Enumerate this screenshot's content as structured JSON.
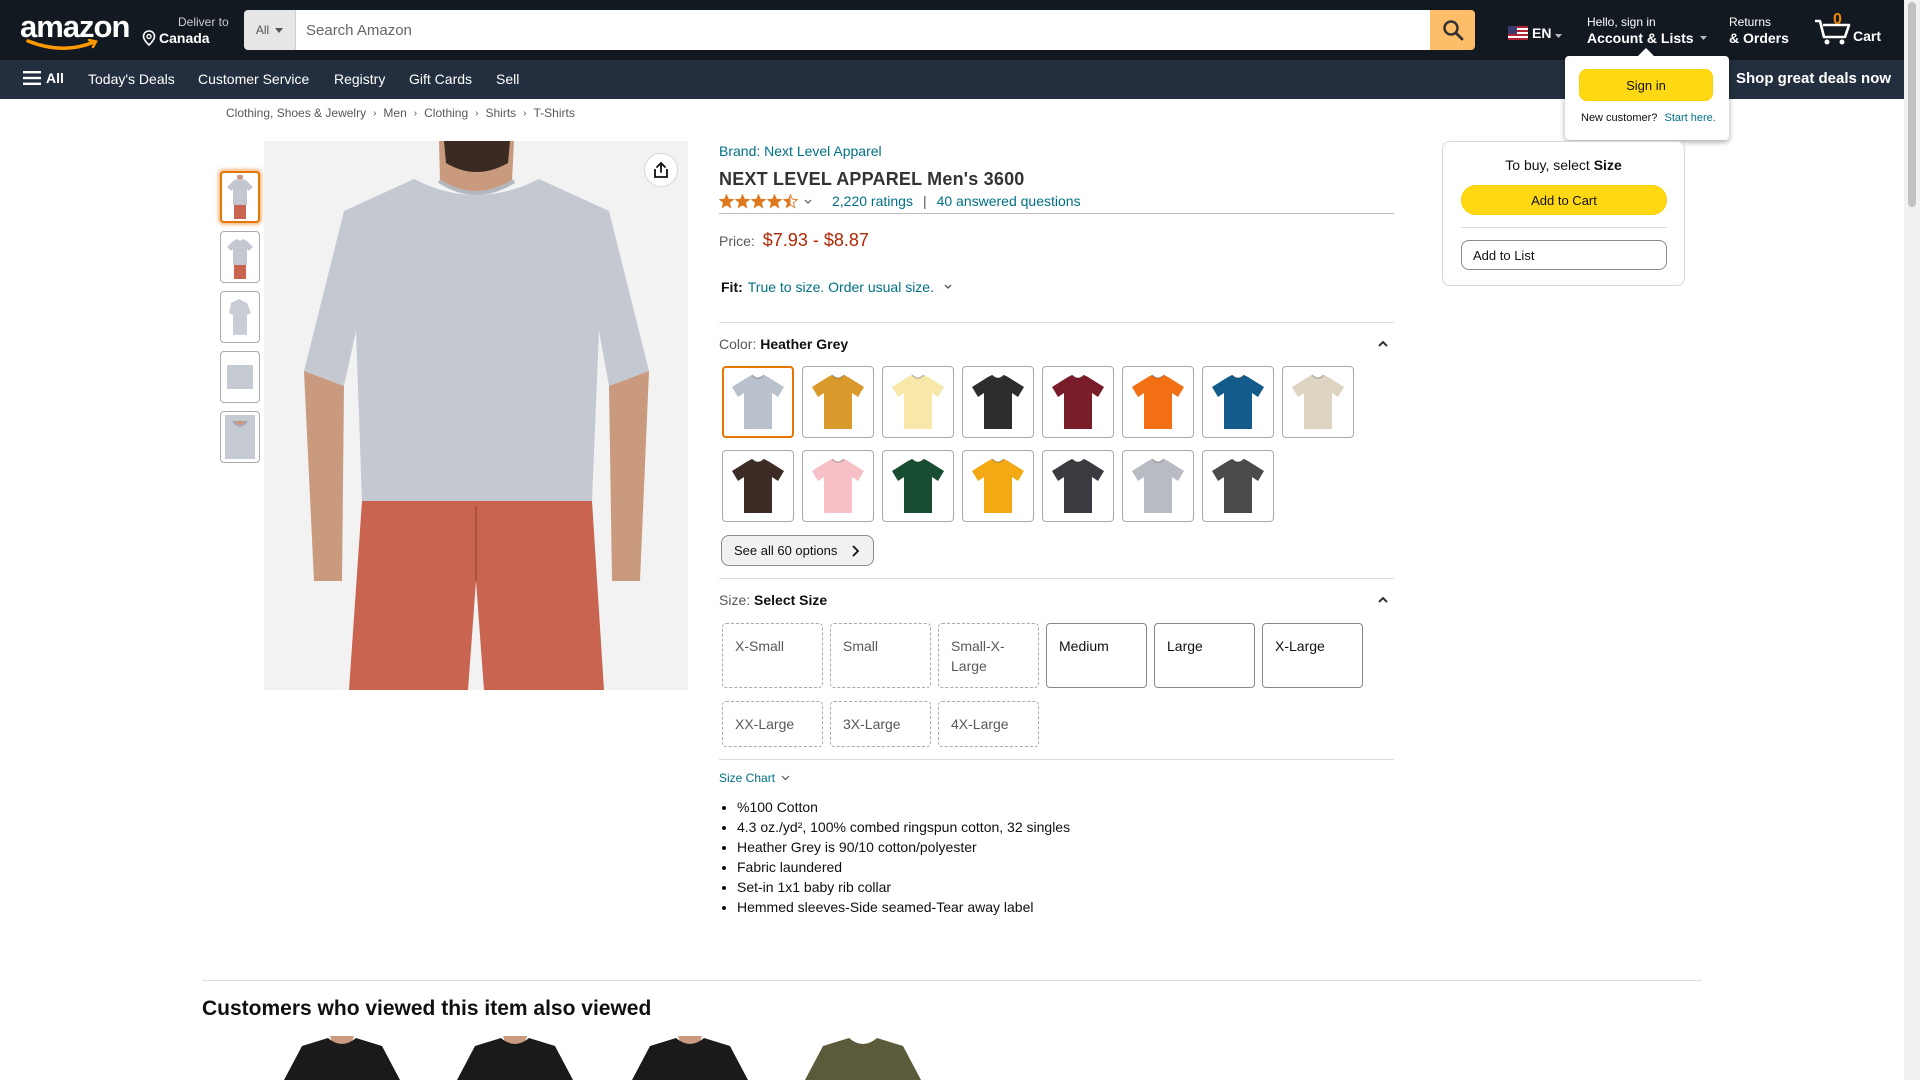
{
  "header": {
    "logo": "amazon",
    "deliver_line1": "Deliver to",
    "deliver_line2": "Canada",
    "search_category": "All",
    "search_placeholder": "Search Amazon",
    "language": "EN",
    "account_line1": "Hello, sign in",
    "account_line2": "Account & Lists",
    "returns_line1": "Returns",
    "returns_line2": "& Orders",
    "cart_count": "0",
    "cart_label": "Cart"
  },
  "subnav": {
    "all_label": "All",
    "items": [
      "Today's Deals",
      "Customer Service",
      "Registry",
      "Gift Cards",
      "Sell"
    ],
    "promo": "Shop great deals now"
  },
  "flyout": {
    "sign_in": "Sign in",
    "new_customer": "New customer?",
    "start_here": "Start here."
  },
  "breadcrumb": [
    "Clothing, Shoes & Jewelry",
    "Men",
    "Clothing",
    "Shirts",
    "T-Shirts"
  ],
  "product": {
    "brand": "Brand: Next Level Apparel",
    "title": "NEXT LEVEL APPAREL Men's 3600",
    "rating": 4.5,
    "ratings_count": "2,220 ratings",
    "separator": "|",
    "questions": "40 answered questions",
    "price_label": "Price:",
    "price": "$7.93 - $8.87",
    "fit_label": "Fit:",
    "fit_value": "True to size. Order usual size.",
    "color_label": "Color:",
    "color_value": "Heather Grey",
    "see_all": "See all 60 options",
    "size_label": "Size:",
    "size_value": "Select Size",
    "sizes": [
      {
        "label": "X-Small",
        "available": false
      },
      {
        "label": "Small",
        "available": false
      },
      {
        "label": "Small-X-Large",
        "available": false
      },
      {
        "label": "Medium",
        "available": true
      },
      {
        "label": "Large",
        "available": true
      },
      {
        "label": "X-Large",
        "available": true
      },
      {
        "label": "XX-Large",
        "available": false
      },
      {
        "label": "3X-Large",
        "available": false
      },
      {
        "label": "4X-Large",
        "available": false
      }
    ],
    "size_chart": "Size Chart",
    "bullets": [
      "%100 Cotton",
      "4.3 oz./yd², 100% combed ringspun cotton, 32 singles",
      "Heather Grey is 90/10 cotton/polyester",
      "Fabric laundered",
      "Set-in 1x1 baby rib collar",
      "Hemmed sleeves-Side seamed-Tear away label"
    ],
    "swatch_colors": [
      "#b9c1cc",
      "#d99a2b",
      "#f7e7a8",
      "#2d2d2d",
      "#7a1d2a",
      "#f36f14",
      "#135b8a",
      "#ddd4c2",
      "#3d2c25",
      "#f6c0c6",
      "#184d32",
      "#f2a914",
      "#3a3a40",
      "#b8bcc2",
      "#4b4b4d"
    ]
  },
  "buybox": {
    "prompt": "To buy, select",
    "prompt_bold": "Size",
    "add_to_cart": "Add to Cart",
    "add_to_list": "Add to List"
  },
  "also_viewed": {
    "title": "Customers who viewed this item also viewed",
    "item_colors": [
      "#1a1a1a",
      "#1a1a1a",
      "#1a1a1a",
      "#5b5a3b"
    ]
  }
}
